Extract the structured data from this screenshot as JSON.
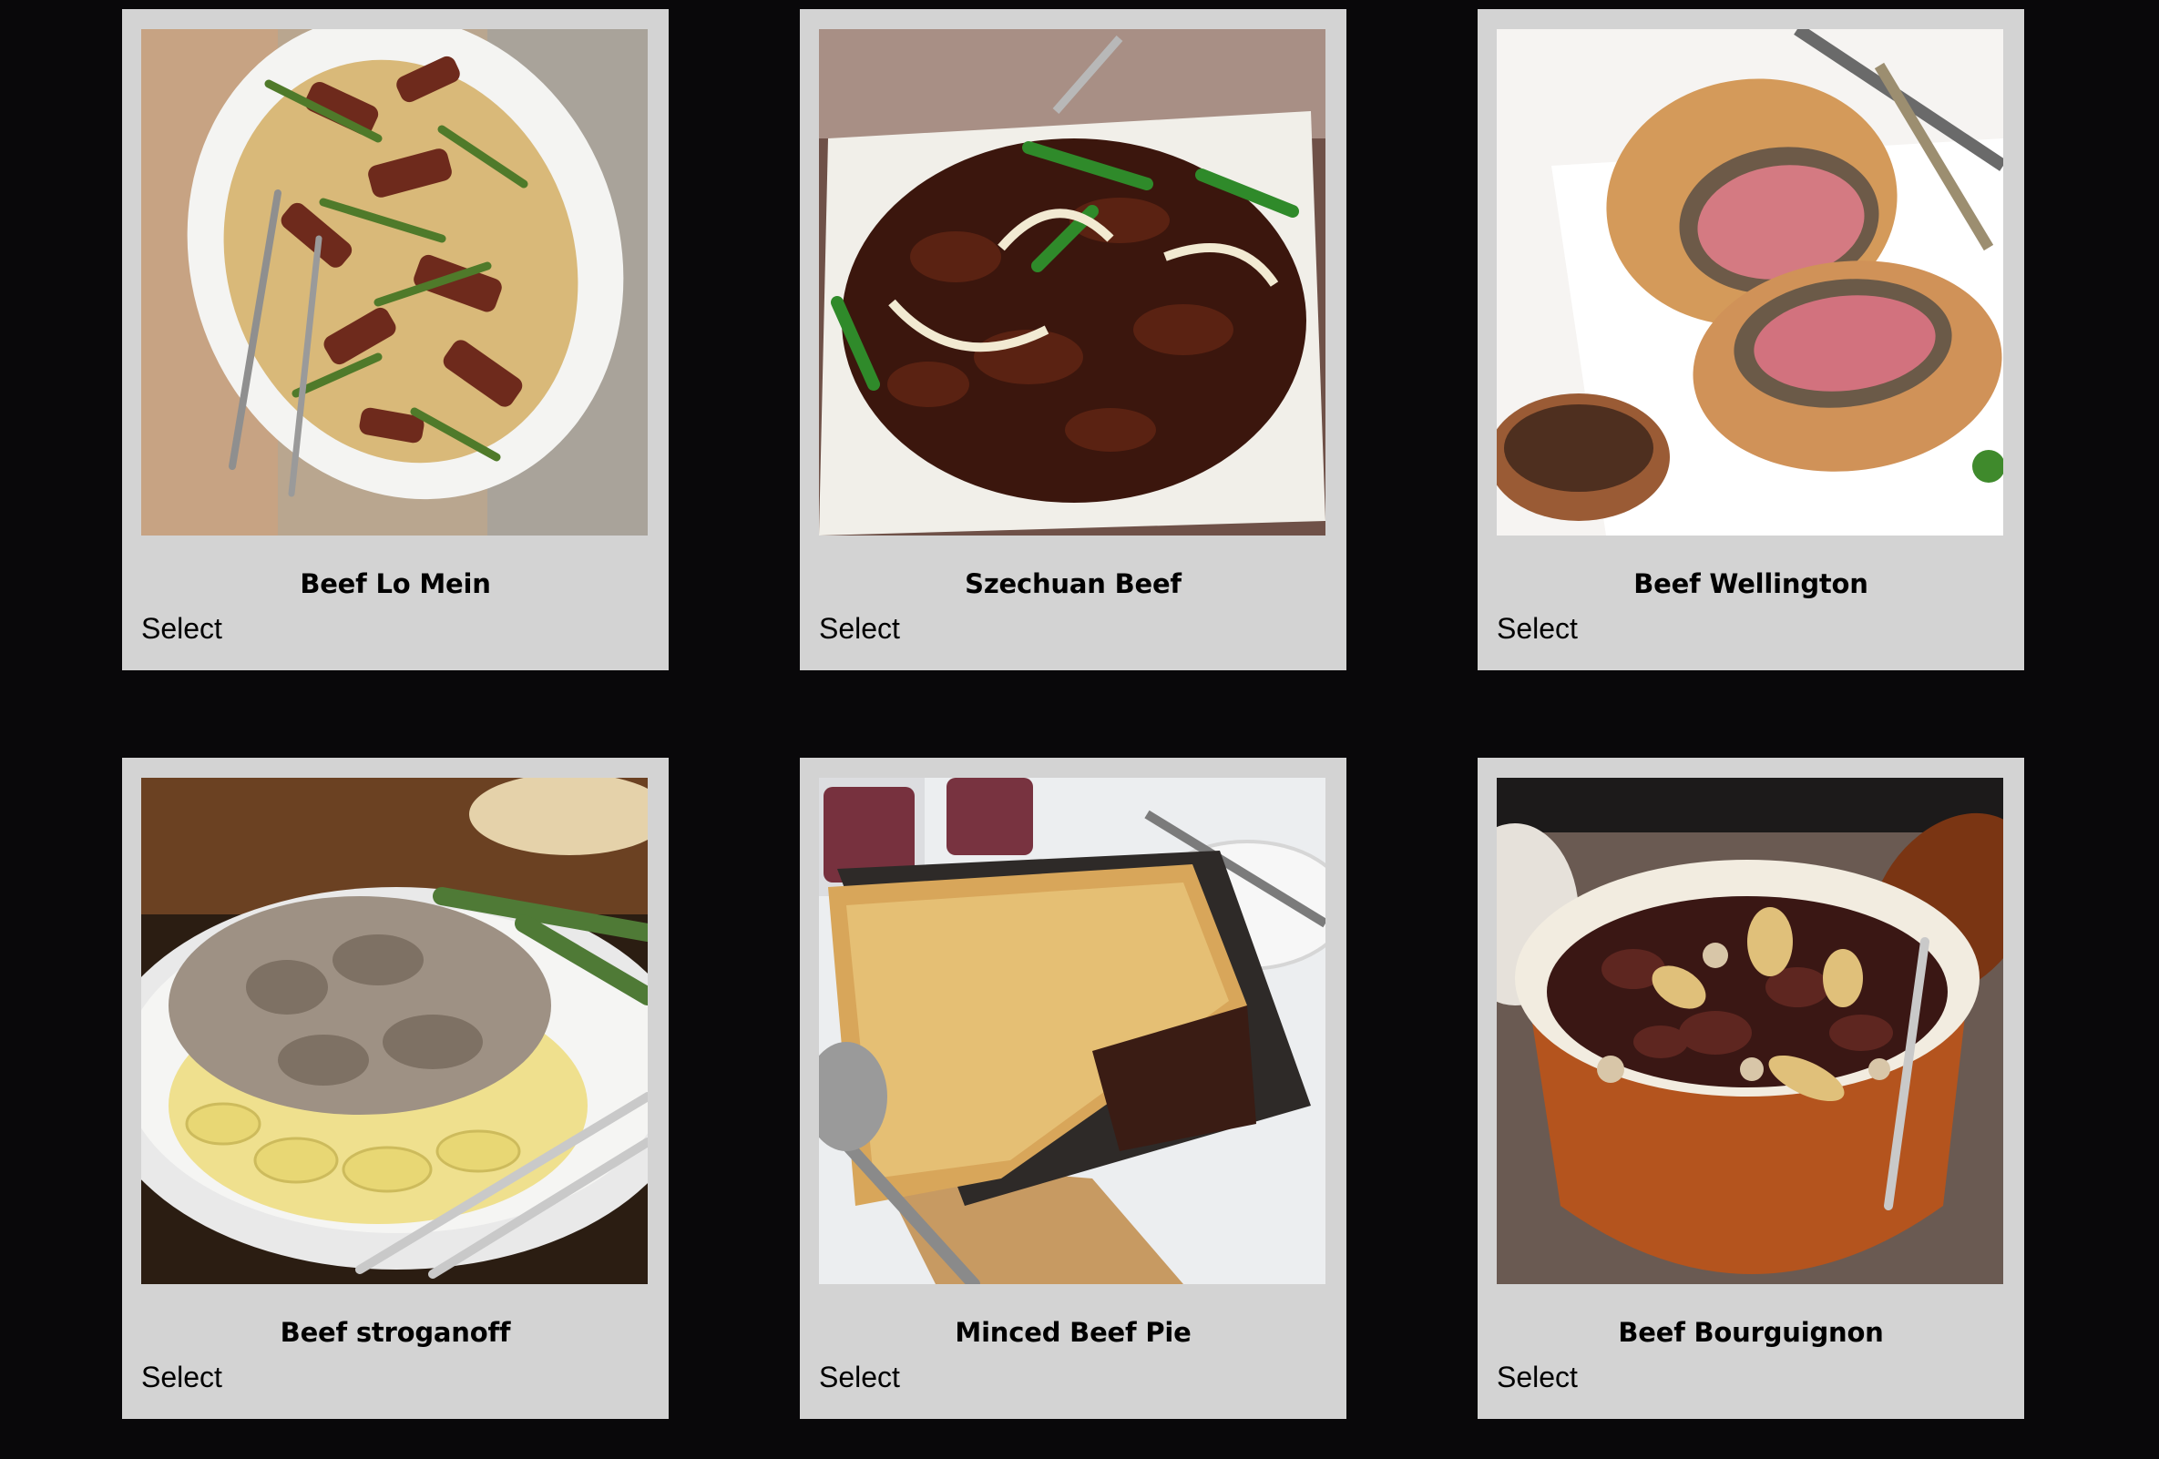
{
  "background_color": "#09080a",
  "card_color": "#d3d3d3",
  "dishes": [
    {
      "title": "Beef Lo Mein",
      "select_label": "Select",
      "image": "beef-lo-mein-photo"
    },
    {
      "title": "Szechuan Beef",
      "select_label": "Select",
      "image": "szechuan-beef-photo"
    },
    {
      "title": "Beef Wellington",
      "select_label": "Select",
      "image": "beef-wellington-photo"
    },
    {
      "title": "Beef stroganoff",
      "select_label": "Select",
      "image": "beef-stroganoff-photo"
    },
    {
      "title": "Minced Beef Pie",
      "select_label": "Select",
      "image": "minced-beef-pie-photo"
    },
    {
      "title": "Beef Bourguignon",
      "select_label": "Select",
      "image": "beef-bourguignon-photo"
    }
  ]
}
